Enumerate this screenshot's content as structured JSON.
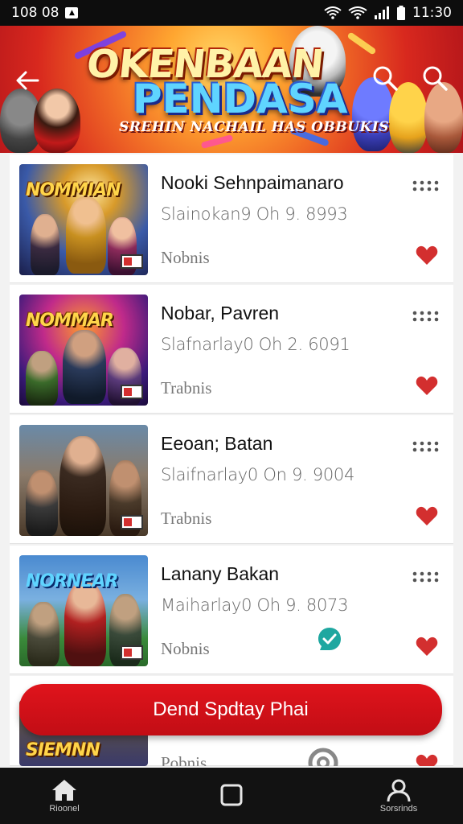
{
  "status_bar": {
    "time_left": "108 08",
    "time_right": "11:30"
  },
  "banner": {
    "title_line1": "OKENBAAN",
    "title_line2": "PENDASA",
    "subtitle": "SREHIN NACHAIL HAS OBBUKIS"
  },
  "items": [
    {
      "title": "Nooki Sehnpaimanaro",
      "meta": "Slainokan9 Oh  9. 8993",
      "tag": "Nobnis",
      "thumb_logo": "NOMMIAN",
      "liked": true,
      "verified": false
    },
    {
      "title": "Nobar, Pavren",
      "meta": "Slafnarlay0 Oh  2. 6091",
      "tag": "Trabnis",
      "thumb_logo": "NOMMAR",
      "liked": true,
      "verified": false
    },
    {
      "title": "Eeoan; Batan",
      "meta": "Slaifnarlay0 On  9. 9004",
      "tag": "Trabnis",
      "thumb_logo": "",
      "liked": true,
      "verified": false
    },
    {
      "title": "Lanany Bakan",
      "meta": "Maiharlay0 Oh  9. 8073",
      "tag": "Nobnis",
      "thumb_logo": "NORNEAR",
      "liked": true,
      "verified": true
    }
  ],
  "peek_item": {
    "tag": "Pobnis",
    "thumb_logo": "SIEMNN"
  },
  "cta_button": {
    "label": "Dend Spdtay Phai"
  },
  "bottom_nav": [
    {
      "label": "Rioonel",
      "icon": "home-icon"
    },
    {
      "label": "",
      "icon": "square-icon"
    },
    {
      "label": "Sorsrinds",
      "icon": "profile-icon"
    }
  ],
  "colors": {
    "accent_red": "#d11a1f",
    "heart_red": "#d32f2f",
    "check_teal": "#1ea7a0",
    "nav_bg": "#121212"
  }
}
